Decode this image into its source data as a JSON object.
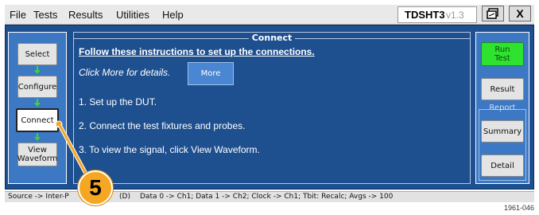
{
  "menubar": {
    "items": [
      "File",
      "Tests",
      "Results",
      "Utilities",
      "Help"
    ],
    "app_name": "TDSHT3",
    "app_version": "v1.3",
    "close_label": "X"
  },
  "panel": {
    "title": "Connect",
    "instructions_heading": "Follow these instructions to set up the connections.",
    "more_hint": "Click More for details.",
    "more_button": "More",
    "steps": [
      "1. Set up the DUT.",
      "2. Connect the test fixtures and probes.",
      "3. To view the signal, click View Waveform."
    ]
  },
  "nav": {
    "select": "Select",
    "configure": "Configure",
    "connect": "Connect",
    "view_waveform": "View\nWaveform"
  },
  "right": {
    "run_test": "Run\nTest",
    "result": "Result",
    "report_label": "Report",
    "summary": "Summary",
    "detail": "Detail"
  },
  "status": {
    "source": "Source -> Inter-P",
    "source_tail": "(D)",
    "mapping": "Data 0 -> Ch1; Data 1 -> Ch2; Clock -> Ch1; Tbit: Recalc; Avgs -> 100"
  },
  "callout_number": "5",
  "figure_number": "1961-046",
  "colors": {
    "panel_bg": "#1e5090",
    "column_bg": "#3c78c3",
    "run_button": "#2fe22f",
    "flow_arrow": "#3bd23b",
    "callout": "#f5a623"
  }
}
